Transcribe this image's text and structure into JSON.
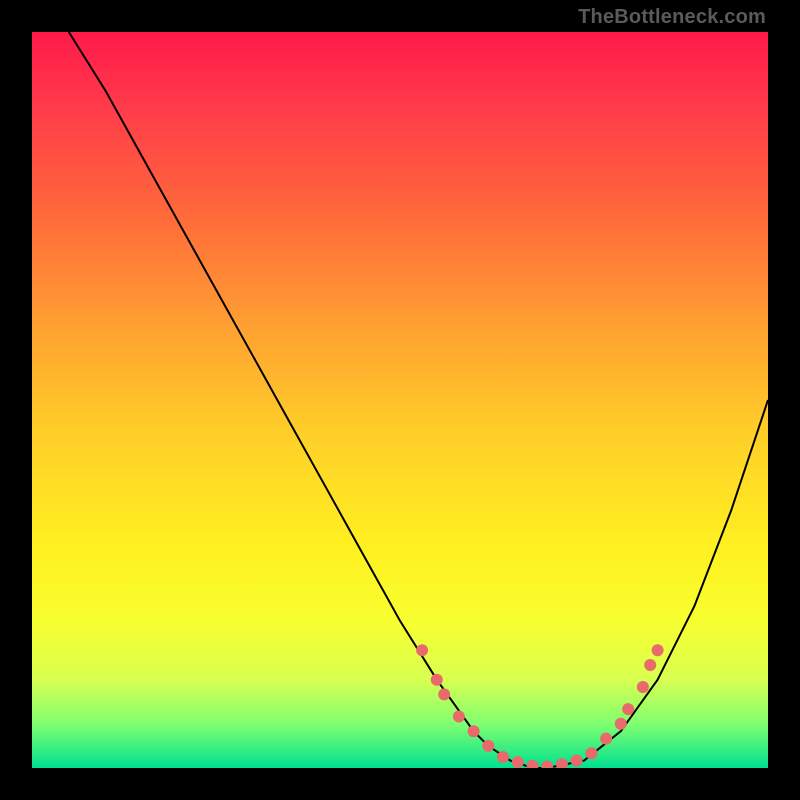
{
  "watermark": "TheBottleneck.com",
  "colors": {
    "background": "#000000",
    "gradient_top": "#ff1a4a",
    "gradient_bottom": "#00e090",
    "curve": "#000000",
    "dots": "#e86a6a"
  },
  "chart_data": {
    "type": "line",
    "title": "",
    "xlabel": "",
    "ylabel": "",
    "xlim": [
      0,
      100
    ],
    "ylim": [
      0,
      100
    ],
    "series": [
      {
        "name": "bottleneck-curve",
        "x": [
          5,
          10,
          15,
          20,
          25,
          30,
          35,
          40,
          45,
          50,
          55,
          60,
          62,
          65,
          68,
          70,
          75,
          80,
          85,
          90,
          95,
          100
        ],
        "y": [
          100,
          92,
          83,
          74,
          65,
          56,
          47,
          38,
          29,
          20,
          12,
          5,
          3,
          1,
          0,
          0,
          1,
          5,
          12,
          22,
          35,
          50
        ]
      }
    ],
    "markers": [
      {
        "x": 53,
        "y": 16
      },
      {
        "x": 55,
        "y": 12
      },
      {
        "x": 56,
        "y": 10
      },
      {
        "x": 58,
        "y": 7
      },
      {
        "x": 60,
        "y": 5
      },
      {
        "x": 62,
        "y": 3
      },
      {
        "x": 64,
        "y": 1.5
      },
      {
        "x": 66,
        "y": 0.8
      },
      {
        "x": 68,
        "y": 0.3
      },
      {
        "x": 70,
        "y": 0.2
      },
      {
        "x": 72,
        "y": 0.5
      },
      {
        "x": 74,
        "y": 1
      },
      {
        "x": 76,
        "y": 2
      },
      {
        "x": 78,
        "y": 4
      },
      {
        "x": 80,
        "y": 6
      },
      {
        "x": 81,
        "y": 8
      },
      {
        "x": 83,
        "y": 11
      },
      {
        "x": 84,
        "y": 14
      },
      {
        "x": 85,
        "y": 16
      }
    ]
  }
}
